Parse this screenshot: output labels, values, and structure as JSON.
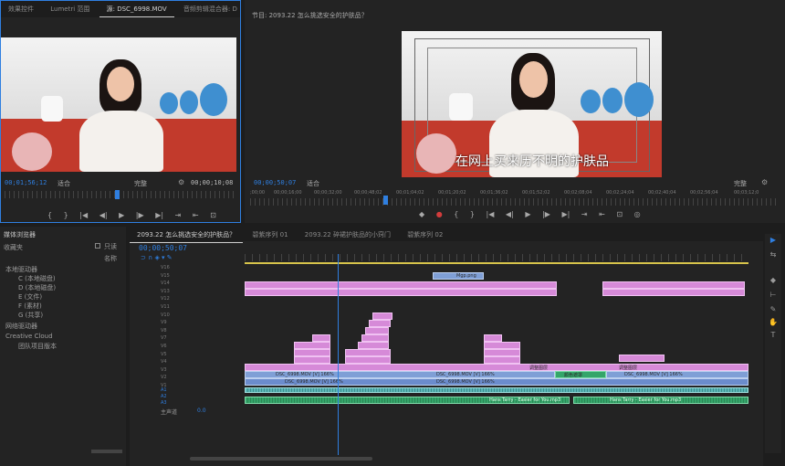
{
  "source_monitor": {
    "tabs": [
      "效果控件",
      "Lumetri 范围",
      "源: DSC_6998.MOV",
      "音频剪辑混合器: D"
    ],
    "timecode_in": "00;01;56;12",
    "fit_left": "适合",
    "fit_right": "完整",
    "timecode_out": "00;00;10;08",
    "controls": [
      "{",
      "}",
      "|◀",
      "◀|",
      "▶",
      "|▶",
      "▶|",
      "⇥",
      "⇤",
      "⊡"
    ]
  },
  "program_monitor": {
    "title": "节目: 2093.22 怎么挑选安全的护肤品？",
    "subtitle": "在网上买来历不明的护肤品",
    "timecode": "00;00;50;07",
    "fit": "适合",
    "quality": "完整",
    "ruler_labels": [
      ";00;00",
      "00;00;16;00",
      "00;00;32;00",
      "00;00;48;02",
      "00;01;04;02",
      "00;01;20;02",
      "00;01;36;02",
      "00;01;52;02",
      "00;02;08;04",
      "00;02;24;04",
      "00;02;40;04",
      "00;02;56;04",
      "00;03;12;0"
    ],
    "controls": [
      "◆",
      "●",
      "{",
      "}",
      "|◀",
      "◀|",
      "▶",
      "|▶",
      "▶|",
      "⇥",
      "⇤",
      "⊡",
      "◎"
    ]
  },
  "project_panel": {
    "title": "媒体浏览器",
    "folder": "收藏夹",
    "readonly_label": "只读",
    "name_label": "名称",
    "items": [
      "本地驱动器",
      "C (本地磁盘)",
      "D (本地磁盘)",
      "E (文件)",
      "F (素材)",
      "G (共享)",
      "网络驱动器",
      "Creative Cloud",
      "团队项目版本"
    ]
  },
  "timeline": {
    "tabs": [
      "2093.22 怎么挑选安全的护肤品？",
      "碧紫序列 01",
      "2093.22 碎裙护肤品的小窍门",
      "碧紫序列 02"
    ],
    "timecode": "00;00;50;07",
    "video_tracks": [
      "V16",
      "V15",
      "V14",
      "V13",
      "V12",
      "V11",
      "V10",
      "V9",
      "V8",
      "V7",
      "V6",
      "V5",
      "V4",
      "V3",
      "V2",
      "V1"
    ],
    "audio_tracks": [
      "A1",
      "A2",
      "A3"
    ],
    "master": "主声道",
    "master_value": "0.0",
    "clip_labels": {
      "video": "DSC_6998.MOV [V] 166%",
      "audio": "Hans Tarry - Easier for You.mp3",
      "fx1": "Mgp.png",
      "fx2": "调整图层",
      "fx3": "颜色遮罩"
    }
  },
  "tools": [
    "▶",
    "⇆",
    "◆",
    "⊢",
    "✎",
    "✋",
    "T"
  ],
  "colors": {
    "accent": "#2f7fe0",
    "pink": "#d68ad8",
    "blue": "#7f9fd6",
    "cyan": "#5ab5b5",
    "green": "#35a56a",
    "bg": "#1d1d1d"
  }
}
